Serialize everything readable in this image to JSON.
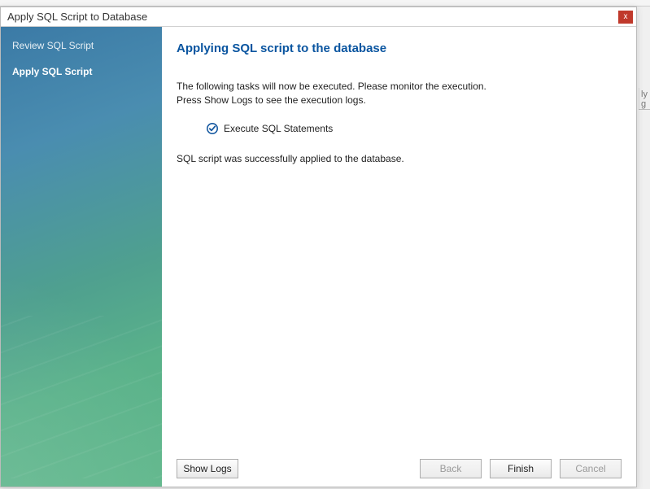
{
  "window": {
    "title": "Apply SQL Script to Database"
  },
  "sidebar": {
    "steps": [
      {
        "label": "Review SQL Script"
      },
      {
        "label": "Apply SQL Script"
      }
    ],
    "active_index": 1
  },
  "heading": "Applying SQL script to the database",
  "description_line1": "The following tasks will now be executed. Please monitor the execution.",
  "description_line2": "Press Show Logs to see the execution logs.",
  "task": {
    "label": "Execute SQL Statements"
  },
  "status": "SQL script was successfully applied to the database.",
  "buttons": {
    "show_logs": "Show Logs",
    "back": "Back",
    "finish": "Finish",
    "cancel": "Cancel"
  },
  "close_glyph": "x",
  "bg_hint": "ly g"
}
